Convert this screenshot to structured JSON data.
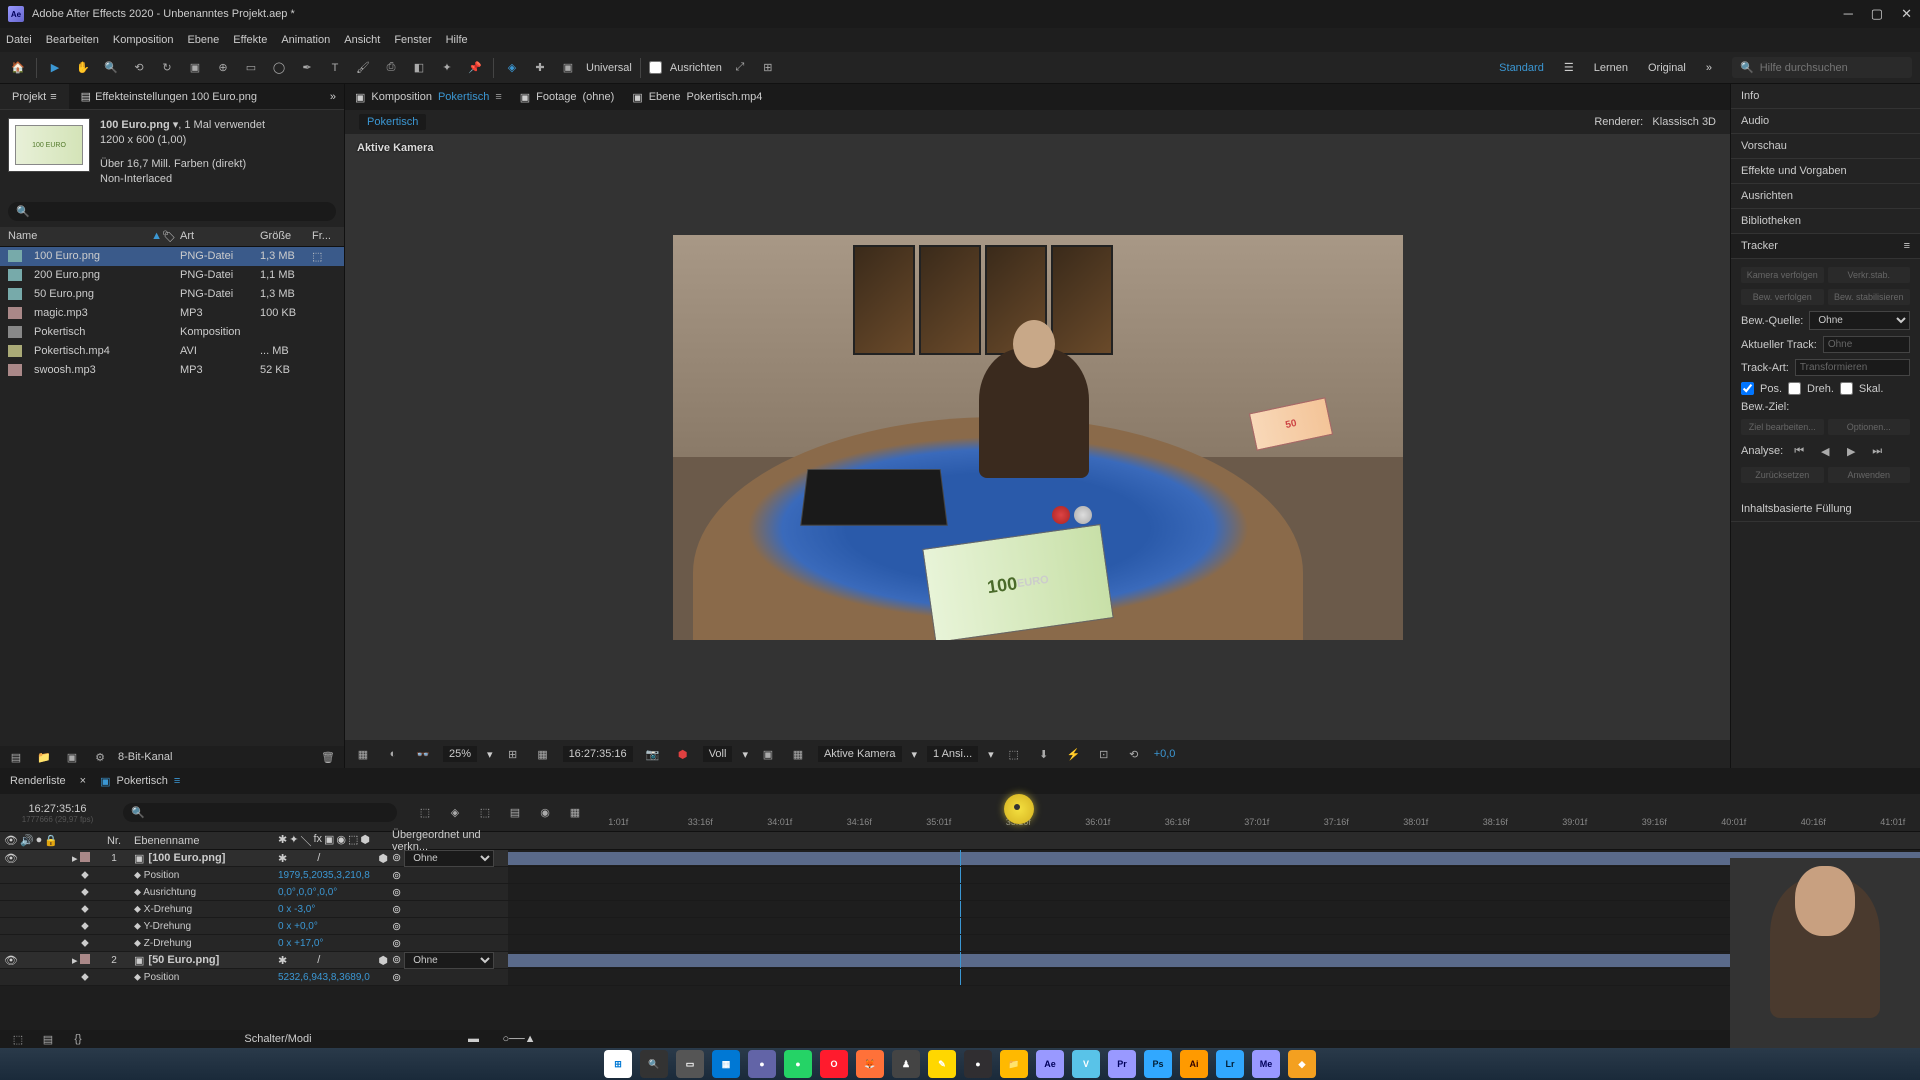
{
  "titlebar": {
    "app": "Adobe After Effects 2020",
    "project": "Unbenanntes Projekt.aep *"
  },
  "menubar": [
    "Datei",
    "Bearbeiten",
    "Komposition",
    "Ebene",
    "Effekte",
    "Animation",
    "Ansicht",
    "Fenster",
    "Hilfe"
  ],
  "toolbar": {
    "universal": "Universal",
    "ausrichten": "Ausrichten",
    "workspace": "Standard",
    "lernen": "Lernen",
    "original": "Original",
    "search_placeholder": "Hilfe durchsuchen"
  },
  "project_panel": {
    "tab": "Projekt",
    "effect_settings_tab": "Effekteinstellungen 100 Euro.png",
    "selected_asset": {
      "name": "100 Euro.png",
      "usage": ", 1 Mal verwendet",
      "dims": "1200 x 600 (1,00)",
      "colors": "Über 16,7 Mill. Farben (direkt)",
      "interlace": "Non-Interlaced"
    },
    "columns": {
      "name": "Name",
      "art": "Art",
      "size": "Größe",
      "fr": "Fr..."
    },
    "assets": [
      {
        "name": "100 Euro.png",
        "type": "PNG-Datei",
        "size": "1,3 MB",
        "ico": "img",
        "selected": true,
        "used": true
      },
      {
        "name": "200 Euro.png",
        "type": "PNG-Datei",
        "size": "1,1 MB",
        "ico": "img"
      },
      {
        "name": "50 Euro.png",
        "type": "PNG-Datei",
        "size": "1,3 MB",
        "ico": "img"
      },
      {
        "name": "magic.mp3",
        "type": "MP3",
        "size": "100 KB",
        "ico": "snd"
      },
      {
        "name": "Pokertisch",
        "type": "Komposition",
        "size": "",
        "ico": "comp"
      },
      {
        "name": "Pokertisch.mp4",
        "type": "AVI",
        "size": "... MB",
        "ico": "vid"
      },
      {
        "name": "swoosh.mp3",
        "type": "MP3",
        "size": "52 KB",
        "ico": "snd"
      }
    ],
    "footer_bpc": "8-Bit-Kanal"
  },
  "comp_panel": {
    "tabs": [
      {
        "label": "Komposition",
        "name": "Pokertisch",
        "active": true
      },
      {
        "label": "Footage",
        "name": "(ohne)"
      },
      {
        "label": "Ebene",
        "name": "Pokertisch.mp4"
      }
    ],
    "breadcrumb": "Pokertisch",
    "renderer_label": "Renderer:",
    "renderer": "Klassisch 3D",
    "camera_label": "Aktive Kamera",
    "controls": {
      "zoom": "25%",
      "timecode": "16:27:35:16",
      "res": "Voll",
      "camera": "Aktive Kamera",
      "views": "1 Ansi...",
      "exposure": "+0,0"
    }
  },
  "right_panel": {
    "sections": [
      "Info",
      "Audio",
      "Vorschau",
      "Effekte und Vorgaben",
      "Ausrichten",
      "Bibliotheken"
    ],
    "tracker": {
      "title": "Tracker",
      "btn_kamera": "Kamera verfolgen",
      "btn_verkr": "Verkr.stab.",
      "btn_bew": "Bew. verfolgen",
      "btn_stab": "Bew. stabilisieren",
      "bew_quelle_label": "Bew.-Quelle:",
      "bew_quelle": "Ohne",
      "aktueller_label": "Aktueller Track:",
      "aktueller": "Ohne",
      "trackart_label": "Track-Art:",
      "trackart": "Transformieren",
      "pos": "Pos.",
      "dreh": "Dreh.",
      "skal": "Skal.",
      "bewziel": "Bew.-Ziel:",
      "ziel_bearb": "Ziel bearbeiten...",
      "optionen": "Optionen...",
      "analyse": "Analyse:",
      "zuruck": "Zurücksetzen",
      "anwenden": "Anwenden"
    },
    "content_fill": "Inhaltsbasierte Füllung"
  },
  "timeline": {
    "tab_render": "Renderliste",
    "tab_comp": "Pokertisch",
    "current_time": "16:27:35:16",
    "frame_info": "1777666 (29,97 fps)",
    "ruler_ticks": [
      "1:01f",
      "33:16f",
      "34:01f",
      "34:16f",
      "35:01f",
      "35:16f",
      "36:01f",
      "36:16f",
      "37:01f",
      "37:16f",
      "38:01f",
      "38:16f",
      "39:01f",
      "39:16f",
      "40:01f",
      "40:16f",
      "41:01f"
    ],
    "playhead_pos": "35:16f",
    "col_nr": "Nr.",
    "col_name": "Ebenenname",
    "col_parent": "Übergeordnet und verkn...",
    "layers": [
      {
        "nr": "1",
        "name": "[100 Euro.png]",
        "parent": "Ohne",
        "props": [
          {
            "name": "Position",
            "value": "1979,5,2035,3,210,8"
          },
          {
            "name": "Ausrichtung",
            "value": "0,0°,0,0°,0,0°"
          },
          {
            "name": "X-Drehung",
            "value": "0 x -3,0°"
          },
          {
            "name": "Y-Drehung",
            "value": "0 x +0,0°"
          },
          {
            "name": "Z-Drehung",
            "value": "0 x +17,0°"
          }
        ]
      },
      {
        "nr": "2",
        "name": "[50 Euro.png]",
        "parent": "Ohne",
        "props": [
          {
            "name": "Position",
            "value": "5232,6,943,8,3689,0"
          }
        ]
      }
    ],
    "footer": "Schalter/Modi"
  },
  "taskbar": {
    "apps": [
      {
        "id": "start",
        "bg": "#fff",
        "txt": "⊞",
        "col": "#0078d4"
      },
      {
        "id": "search",
        "bg": "#333",
        "txt": "🔍"
      },
      {
        "id": "task",
        "bg": "#555",
        "txt": "▭"
      },
      {
        "id": "widgets",
        "bg": "#0078d4",
        "txt": "▦"
      },
      {
        "id": "teams",
        "bg": "#6264a7",
        "txt": "●"
      },
      {
        "id": "whatsapp",
        "bg": "#25d366",
        "txt": "●"
      },
      {
        "id": "opera",
        "bg": "#ff1b2d",
        "txt": "O"
      },
      {
        "id": "firefox",
        "bg": "#ff7139",
        "txt": "🦊"
      },
      {
        "id": "chess",
        "bg": "#444",
        "txt": "♟"
      },
      {
        "id": "notes",
        "bg": "#ffd700",
        "txt": "✎"
      },
      {
        "id": "obs",
        "bg": "#302e31",
        "txt": "●"
      },
      {
        "id": "explorer",
        "bg": "#ffb900",
        "txt": "📁"
      },
      {
        "id": "ae",
        "bg": "#9999ff",
        "txt": "Ae",
        "col": "#00005b"
      },
      {
        "id": "vegas",
        "bg": "#59c3e8",
        "txt": "V"
      },
      {
        "id": "pr",
        "bg": "#9999ff",
        "txt": "Pr",
        "col": "#00005b"
      },
      {
        "id": "ps",
        "bg": "#31a8ff",
        "txt": "Ps",
        "col": "#001e36"
      },
      {
        "id": "ai",
        "bg": "#ff9a00",
        "txt": "Ai",
        "col": "#330000"
      },
      {
        "id": "lr",
        "bg": "#31a8ff",
        "txt": "Lr",
        "col": "#001e36"
      },
      {
        "id": "me",
        "bg": "#9999ff",
        "txt": "Me",
        "col": "#00005b"
      },
      {
        "id": "misc",
        "bg": "#f4a020",
        "txt": "◆"
      }
    ]
  }
}
